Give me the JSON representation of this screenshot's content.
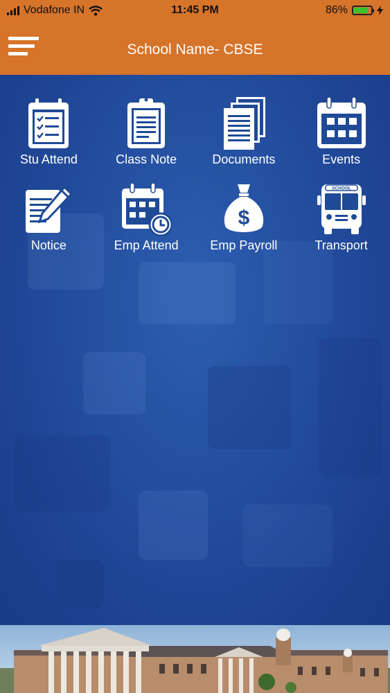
{
  "status_bar": {
    "carrier": "Vodafone IN",
    "time": "11:45 PM",
    "battery_percent": "86%",
    "battery_level": 0.86,
    "battery_color": "#38c42c"
  },
  "header": {
    "title": "School Name- CBSE",
    "menu_icon": "hamburger-menu-icon",
    "background": "#d6742a"
  },
  "modules": [
    {
      "label": "Stu Attend",
      "icon": "checklist-clipboard-icon"
    },
    {
      "label": "Class Note",
      "icon": "clipboard-note-icon"
    },
    {
      "label": "Documents",
      "icon": "documents-stack-icon"
    },
    {
      "label": "Events",
      "icon": "calendar-icon"
    },
    {
      "label": "Notice",
      "icon": "notepad-pencil-icon"
    },
    {
      "label": "Emp Attend",
      "icon": "calendar-clock-icon"
    },
    {
      "label": "Emp Payroll",
      "icon": "money-bag-icon"
    },
    {
      "label": "Transport",
      "icon": "school-bus-icon"
    }
  ],
  "bus_sign": "SCHOOL",
  "footer": {
    "image": "school-building-photo"
  }
}
